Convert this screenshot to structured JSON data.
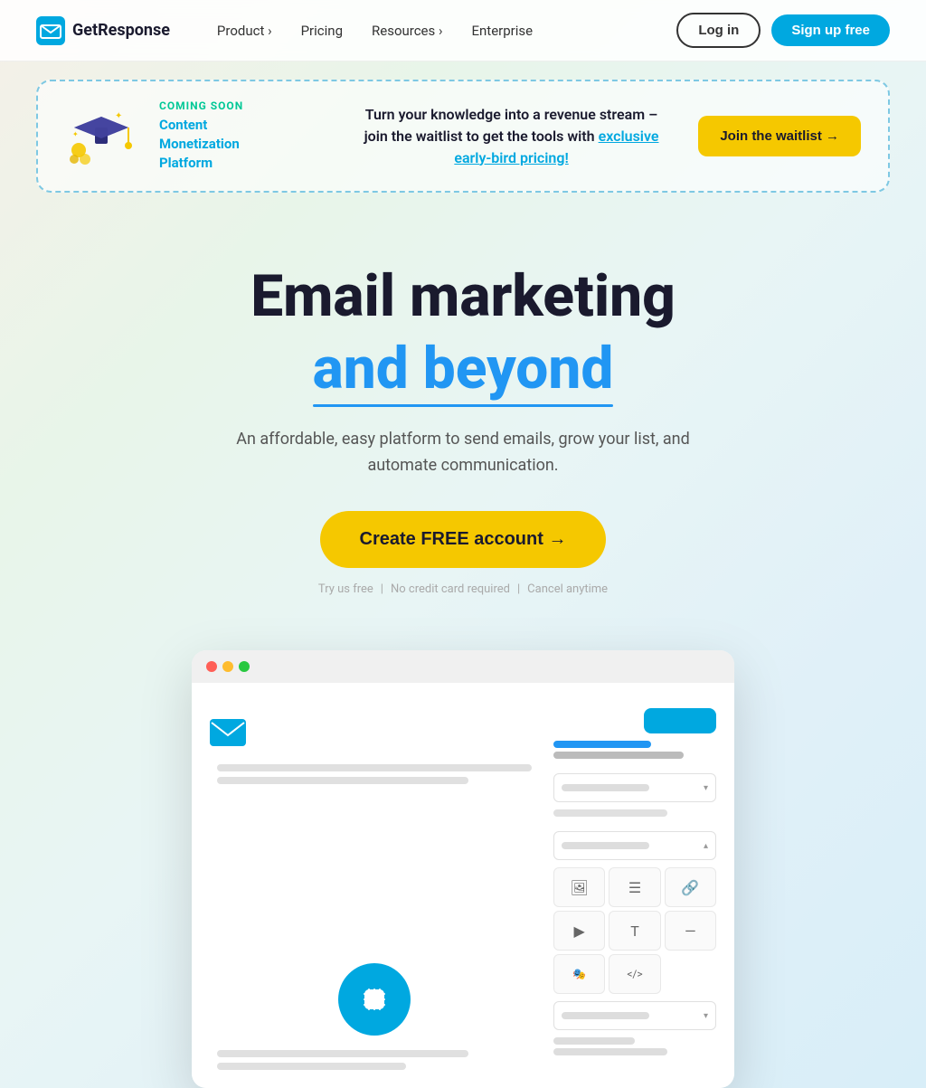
{
  "brand": {
    "name": "GetResponse",
    "logo_alt": "GetResponse logo"
  },
  "nav": {
    "links": [
      {
        "label": "Product ›",
        "id": "product"
      },
      {
        "label": "Pricing",
        "id": "pricing"
      },
      {
        "label": "Resources ›",
        "id": "resources"
      },
      {
        "label": "Enterprise",
        "id": "enterprise"
      }
    ],
    "login_label": "Log in",
    "signup_label": "Sign up free"
  },
  "banner": {
    "coming_soon": "COMING SOON",
    "platform_title_line1": "Content",
    "platform_title_line2": "Monetization",
    "platform_title_line3": "Platform",
    "main_text_before": "Turn your knowledge into a revenue stream –\njoin the waitlist to get the tools with ",
    "main_text_link": "exclusive early-bird pricing!",
    "waitlist_btn": "Join the waitlist →"
  },
  "hero": {
    "title": "Email marketing",
    "subtitle": "and beyond",
    "description": "An affordable, easy platform to send emails, grow your list, and automate communication.",
    "cta_label": "Create FREE account →",
    "trust": {
      "part1": "Try us free",
      "sep1": "|",
      "part2": "No credit card required",
      "sep2": "|",
      "part3": "Cancel anytime"
    }
  },
  "mockup": {
    "window_controls": [
      "red",
      "yellow",
      "green"
    ],
    "icon_grid": [
      "🖼",
      "☰",
      "🔗",
      "▶",
      "T",
      "—",
      "🎭",
      "</>"
    ]
  }
}
